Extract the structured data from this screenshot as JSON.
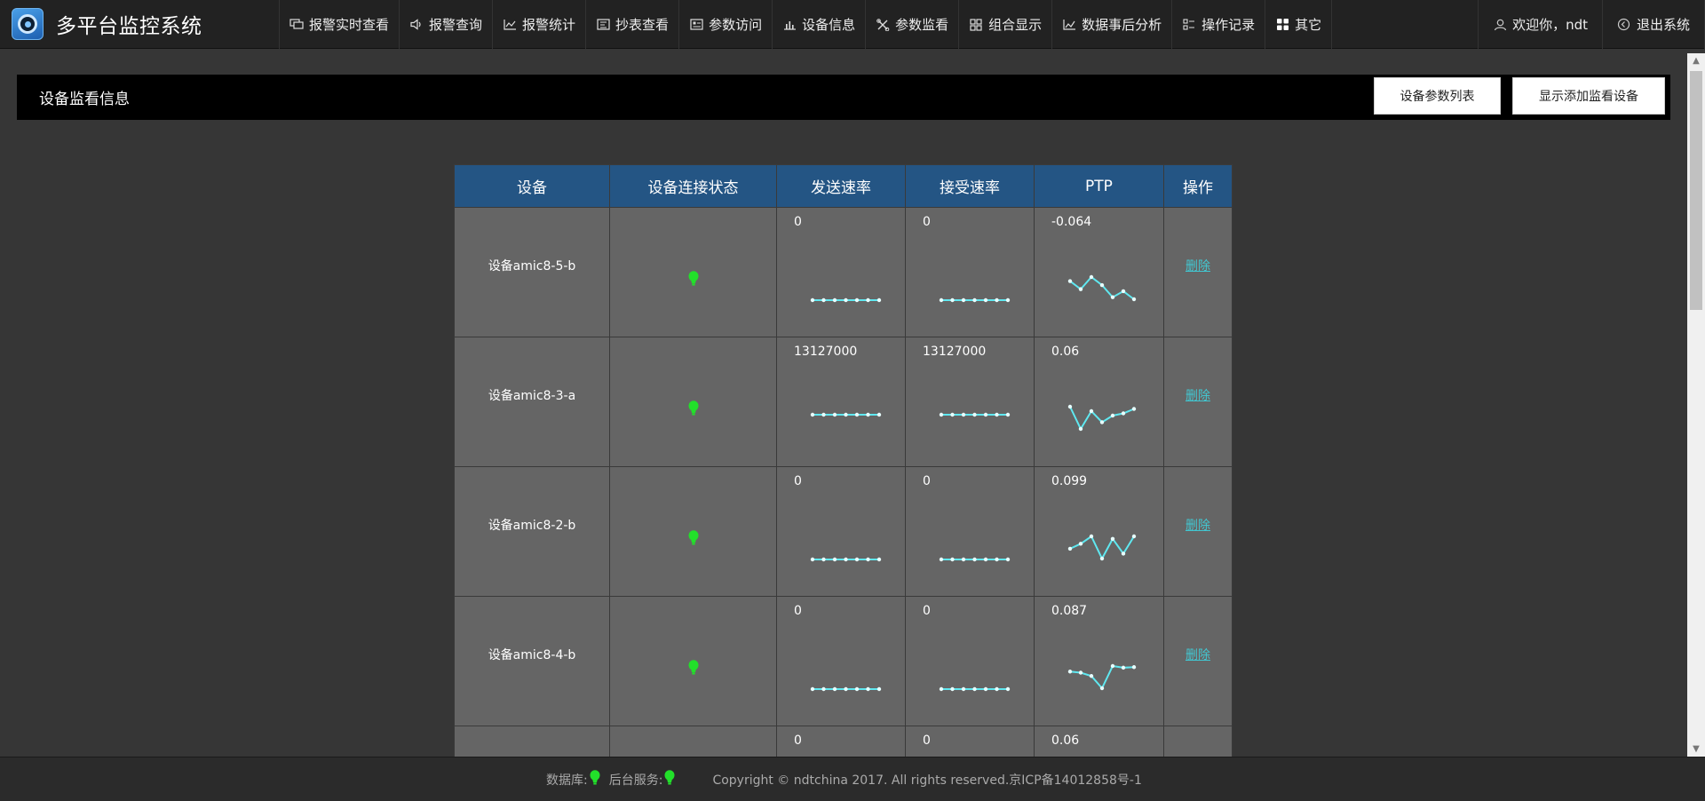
{
  "app": {
    "title": "多平台监控系统"
  },
  "nav": [
    {
      "label": "报警实时查看",
      "icon": "monitor-icon"
    },
    {
      "label": "报警查询",
      "icon": "speaker-icon"
    },
    {
      "label": "报警统计",
      "icon": "line-chart-icon"
    },
    {
      "label": "抄表查看",
      "icon": "meter-icon"
    },
    {
      "label": "参数访问",
      "icon": "param-icon"
    },
    {
      "label": "设备信息",
      "icon": "bar-chart-icon"
    },
    {
      "label": "参数监看",
      "icon": "tools-icon"
    },
    {
      "label": "组合显示",
      "icon": "grid-icon"
    },
    {
      "label": "数据事后分析",
      "icon": "analysis-icon"
    },
    {
      "label": "操作记录",
      "icon": "list-icon"
    },
    {
      "label": "其它",
      "icon": "apps-icon"
    }
  ],
  "user": {
    "welcome": "欢迎你，ndt",
    "logout": "退出系统"
  },
  "panel": {
    "title": "设备监看信息",
    "btn_param_list": "设备参数列表",
    "btn_show_add": "显示添加监看设备"
  },
  "table": {
    "headers": [
      "设备",
      "设备连接状态",
      "发送速率",
      "接受速率",
      "PTP",
      "操作"
    ],
    "rows": [
      {
        "name": "设备amic8-5-b",
        "send": "0",
        "recv": "0",
        "ptp": "-0.064",
        "action": "删除",
        "send_series": [
          0,
          0,
          0,
          0,
          0,
          0,
          0
        ],
        "recv_series": [
          0,
          0,
          0,
          0,
          0,
          0,
          0
        ],
        "ptp_series": [
          -0.05,
          -0.07,
          -0.04,
          -0.06,
          -0.09,
          -0.075,
          -0.095
        ]
      },
      {
        "name": "设备amic8-3-a",
        "send": "13127000",
        "recv": "13127000",
        "ptp": "0.06",
        "action": "删除",
        "send_series": [
          13127000,
          13127000,
          13127000,
          13127000,
          13127000,
          13127000,
          13127000
        ],
        "recv_series": [
          13127000,
          13127000,
          13127000,
          13127000,
          13127000,
          13127000,
          13127000
        ],
        "ptp_series": [
          0.08,
          0.03,
          0.07,
          0.045,
          0.06,
          0.065,
          0.075
        ]
      },
      {
        "name": "设备amic8-2-b",
        "send": "0",
        "recv": "0",
        "ptp": "0.099",
        "action": "删除",
        "send_series": [
          0,
          0,
          0,
          0,
          0,
          0,
          0
        ],
        "recv_series": [
          0,
          0,
          0,
          0,
          0,
          0,
          0
        ],
        "ptp_series": [
          0.08,
          0.09,
          0.105,
          0.06,
          0.1,
          0.07,
          0.105
        ]
      },
      {
        "name": "设备amic8-4-b",
        "send": "0",
        "recv": "0",
        "ptp": "0.087",
        "action": "删除",
        "send_series": [
          0,
          0,
          0,
          0,
          0,
          0,
          0
        ],
        "recv_series": [
          0,
          0,
          0,
          0,
          0,
          0,
          0
        ],
        "ptp_series": [
          0.09,
          0.088,
          0.082,
          0.06,
          0.1,
          0.097,
          0.098
        ]
      },
      {
        "name": "",
        "send": "0",
        "recv": "0",
        "ptp": "0.06",
        "action": ""
      }
    ]
  },
  "footer": {
    "db_label": "数据库:",
    "svc_label": "后台服务:",
    "copyright": "Copyright © ndtchina 2017. All rights reserved.京ICP备14012858号-1"
  },
  "colors": {
    "header_bg": "#245584",
    "cell_bg": "#656565",
    "spark": "#5fe8f0",
    "bulb_ok": "#22e02a",
    "link": "#42c6d0"
  }
}
